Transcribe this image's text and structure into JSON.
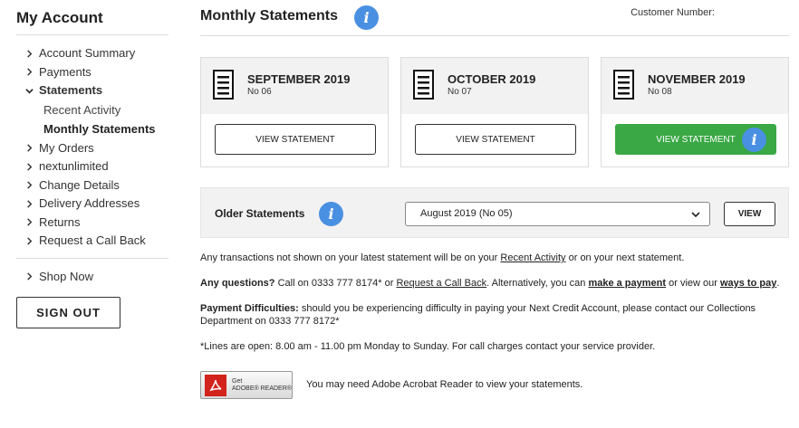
{
  "sidebar": {
    "title": "My Account",
    "items": [
      {
        "label": "Account Summary"
      },
      {
        "label": "Payments"
      },
      {
        "label": "Statements"
      },
      {
        "label": "My Orders"
      },
      {
        "label": "nextunlimited"
      },
      {
        "label": "Change Details"
      },
      {
        "label": "Delivery Addresses"
      },
      {
        "label": "Returns"
      },
      {
        "label": "Request a Call Back"
      }
    ],
    "subitems": [
      {
        "label": "Recent Activity"
      },
      {
        "label": "Monthly Statements"
      }
    ],
    "shop_now": "Shop Now",
    "sign_out": "SIGN OUT"
  },
  "header": {
    "title": "Monthly Statements",
    "customer_number_label": "Customer Number:"
  },
  "statements": [
    {
      "month": "SEPTEMBER 2019",
      "number": "No 06",
      "button": "VIEW STATEMENT"
    },
    {
      "month": "OCTOBER 2019",
      "number": "No 07",
      "button": "VIEW STATEMENT"
    },
    {
      "month": "NOVEMBER 2019",
      "number": "No 08",
      "button": "VIEW STATEMENT"
    }
  ],
  "older": {
    "label": "Older Statements",
    "selected": "August 2019 (No 05)",
    "view": "VIEW"
  },
  "info": {
    "p1_a": "Any transactions not shown on your latest statement will be on your ",
    "p1_link": "Recent Activity",
    "p1_b": " or on your next statement.",
    "p2_bold": "Any questions?",
    "p2_a": " Call on 0333 777 8174* or ",
    "p2_link1": "Request a Call Back",
    "p2_b": ". Alternatively, you can ",
    "p2_link2": "make a payment",
    "p2_c": " or view our ",
    "p2_link3": "ways to pay",
    "p2_d": ".",
    "p3_bold": "Payment Difficulties:",
    "p3_text": " should you be experiencing difficulty in paying your Next Credit Account, please contact our Collections Department on 0333 777 8172*",
    "p4": "*Lines are open: 8.00 am - 11.00 pm Monday to Sunday. For call charges contact your service provider."
  },
  "adobe": {
    "get": "Get",
    "brand": "ADOBE® READER®",
    "note": "You may need Adobe Acrobat Reader to view your statements."
  },
  "colors": {
    "primary_button": "#3aa845",
    "info_icon": "#4a90e2",
    "panel_bg": "#f2f2f2"
  }
}
